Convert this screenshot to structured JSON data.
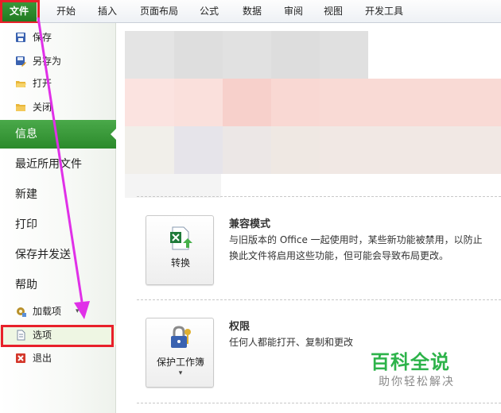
{
  "ribbon": {
    "tabs": [
      "文件",
      "开始",
      "插入",
      "页面布局",
      "公式",
      "数据",
      "审阅",
      "视图",
      "开发工具"
    ]
  },
  "backstage": {
    "quick_commands": [
      "保存",
      "另存为",
      "打开",
      "关闭"
    ],
    "nav_items": [
      "信息",
      "最近所用文件",
      "新建",
      "打印",
      "保存并发送",
      "帮助"
    ],
    "addins": "加载项",
    "options": "选项",
    "exit": "退出"
  },
  "main": {
    "compat": {
      "button_label": "转换",
      "title": "兼容模式",
      "line1": "与旧版本的 Office 一起使用时，某些新功能被禁用，以防止",
      "line2": "换此文件将启用这些功能，但可能会导致布局更改。"
    },
    "permissions": {
      "button_label": "保护工作簿",
      "title": "权限",
      "line1": "任何人都能打开、复制和更改"
    }
  },
  "watermark": {
    "title": "百科全说",
    "subtitle": "助你轻松解决"
  },
  "colors": {
    "file_tab": "#2b8a2b",
    "active_nav": "#3a9d3a",
    "highlight_box": "#e8202a",
    "arrow": "#e030e8",
    "watermark": "#2db34a"
  }
}
